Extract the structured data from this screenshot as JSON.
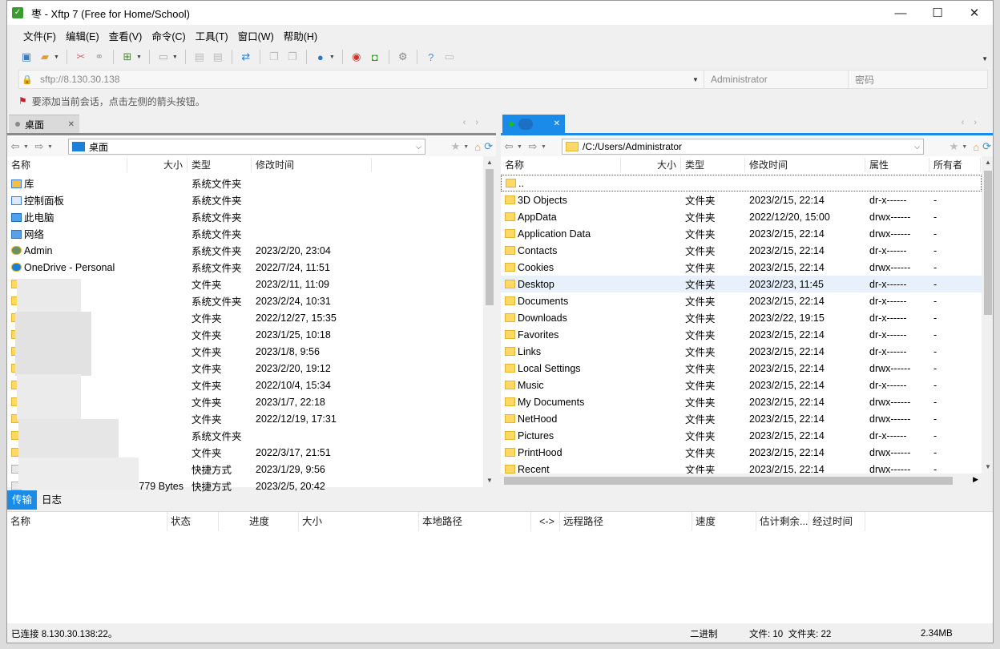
{
  "window": {
    "title": "枣 - Xftp 7 (Free for Home/School)",
    "app_icon": "xftp-icon",
    "minimize": "—",
    "maximize": "☐",
    "close": "✕"
  },
  "menu": [
    "文件(F)",
    "编辑(E)",
    "查看(V)",
    "命令(C)",
    "工具(T)",
    "窗口(W)",
    "帮助(H)"
  ],
  "address": {
    "url": "sftp://8.130.30.138",
    "username_placeholder": "Administrator",
    "password_placeholder": "密码"
  },
  "hint": "要添加当前会话，点击左侧的箭头按钮。",
  "left_pane": {
    "tab_label": "桌面",
    "path": "桌面",
    "columns": [
      "名称",
      "大小",
      "类型",
      "修改时间"
    ],
    "rows": [
      {
        "name": "库",
        "size": "",
        "type": "系统文件夹",
        "modified": "",
        "icon": "library-icon"
      },
      {
        "name": "控制面板",
        "size": "",
        "type": "系统文件夹",
        "modified": "",
        "icon": "control-panel-icon"
      },
      {
        "name": "此电脑",
        "size": "",
        "type": "系统文件夹",
        "modified": "",
        "icon": "computer-icon"
      },
      {
        "name": "网络",
        "size": "",
        "type": "系统文件夹",
        "modified": "",
        "icon": "network-icon"
      },
      {
        "name": "Admin",
        "size": "",
        "type": "系统文件夹",
        "modified": "2023/2/20, 23:04",
        "icon": "user-icon"
      },
      {
        "name": "OneDrive - Personal",
        "size": "",
        "type": "系统文件夹",
        "modified": "2022/7/24, 11:51",
        "icon": "cloud-icon"
      },
      {
        "name": "",
        "size": "",
        "type": "文件夹",
        "modified": "2023/2/11, 11:09",
        "icon": "folder-icon"
      },
      {
        "name": "",
        "size": "",
        "type": "系统文件夹",
        "modified": "2023/2/24, 10:31",
        "icon": "folder-icon"
      },
      {
        "name": "",
        "size": "",
        "type": "文件夹",
        "modified": "2022/12/27, 15:35",
        "icon": "folder-icon"
      },
      {
        "name": "",
        "size": "",
        "type": "文件夹",
        "modified": "2023/1/25, 10:18",
        "icon": "folder-icon"
      },
      {
        "name": "",
        "size": "",
        "type": "文件夹",
        "modified": "2023/1/8, 9:56",
        "icon": "folder-icon"
      },
      {
        "name": "",
        "size": "",
        "type": "文件夹",
        "modified": "2023/2/20, 19:12",
        "icon": "folder-icon"
      },
      {
        "name": "",
        "size": "",
        "type": "文件夹",
        "modified": "2022/10/4, 15:34",
        "icon": "folder-icon"
      },
      {
        "name": "",
        "size": "",
        "type": "文件夹",
        "modified": "2023/1/7, 22:18",
        "icon": "folder-icon"
      },
      {
        "name": "",
        "size": "",
        "type": "文件夹",
        "modified": "2022/12/19, 17:31",
        "icon": "folder-icon"
      },
      {
        "name": "",
        "size": "",
        "type": "系统文件夹",
        "modified": "",
        "icon": "folder-icon"
      },
      {
        "name": "",
        "size": "",
        "type": "文件夹",
        "modified": "2022/3/17, 21:51",
        "icon": "folder-icon"
      },
      {
        "name": "",
        "size": "",
        "type": "快捷方式",
        "modified": "2023/1/29, 9:56",
        "icon": "shortcut-icon"
      },
      {
        "name": "",
        "size": "779 Bytes",
        "type": "快捷方式",
        "modified": "2023/2/5, 20:42",
        "icon": "shortcut-icon"
      }
    ]
  },
  "right_pane": {
    "tab_label": "",
    "path": "/C:/Users/Administrator",
    "columns": [
      "名称",
      "大小",
      "类型",
      "修改时间",
      "属性",
      "所有者"
    ],
    "parent_row": "..",
    "rows": [
      {
        "name": "3D Objects",
        "size": "",
        "type": "文件夹",
        "modified": "2023/2/15, 22:14",
        "attr": "dr-x------",
        "owner": "-"
      },
      {
        "name": "AppData",
        "size": "",
        "type": "文件夹",
        "modified": "2022/12/20, 15:00",
        "attr": "drwx------",
        "owner": "-"
      },
      {
        "name": "Application Data",
        "size": "",
        "type": "文件夹",
        "modified": "2023/2/15, 22:14",
        "attr": "drwx------",
        "owner": "-"
      },
      {
        "name": "Contacts",
        "size": "",
        "type": "文件夹",
        "modified": "2023/2/15, 22:14",
        "attr": "dr-x------",
        "owner": "-"
      },
      {
        "name": "Cookies",
        "size": "",
        "type": "文件夹",
        "modified": "2023/2/15, 22:14",
        "attr": "drwx------",
        "owner": "-"
      },
      {
        "name": "Desktop",
        "size": "",
        "type": "文件夹",
        "modified": "2023/2/23, 11:45",
        "attr": "dr-x------",
        "owner": "-"
      },
      {
        "name": "Documents",
        "size": "",
        "type": "文件夹",
        "modified": "2023/2/15, 22:14",
        "attr": "dr-x------",
        "owner": "-"
      },
      {
        "name": "Downloads",
        "size": "",
        "type": "文件夹",
        "modified": "2023/2/22, 19:15",
        "attr": "dr-x------",
        "owner": "-"
      },
      {
        "name": "Favorites",
        "size": "",
        "type": "文件夹",
        "modified": "2023/2/15, 22:14",
        "attr": "dr-x------",
        "owner": "-"
      },
      {
        "name": "Links",
        "size": "",
        "type": "文件夹",
        "modified": "2023/2/15, 22:14",
        "attr": "dr-x------",
        "owner": "-"
      },
      {
        "name": "Local Settings",
        "size": "",
        "type": "文件夹",
        "modified": "2023/2/15, 22:14",
        "attr": "drwx------",
        "owner": "-"
      },
      {
        "name": "Music",
        "size": "",
        "type": "文件夹",
        "modified": "2023/2/15, 22:14",
        "attr": "dr-x------",
        "owner": "-"
      },
      {
        "name": "My Documents",
        "size": "",
        "type": "文件夹",
        "modified": "2023/2/15, 22:14",
        "attr": "drwx------",
        "owner": "-"
      },
      {
        "name": "NetHood",
        "size": "",
        "type": "文件夹",
        "modified": "2023/2/15, 22:14",
        "attr": "drwx------",
        "owner": "-"
      },
      {
        "name": "Pictures",
        "size": "",
        "type": "文件夹",
        "modified": "2023/2/15, 22:14",
        "attr": "dr-x------",
        "owner": "-"
      },
      {
        "name": "PrintHood",
        "size": "",
        "type": "文件夹",
        "modified": "2023/2/15, 22:14",
        "attr": "drwx------",
        "owner": "-"
      },
      {
        "name": "Recent",
        "size": "",
        "type": "文件夹",
        "modified": "2023/2/15, 22:14",
        "attr": "drwx------",
        "owner": "-"
      }
    ],
    "selected_row": "Desktop"
  },
  "bottom": {
    "tabs": [
      "传输",
      "日志"
    ],
    "columns": [
      "名称",
      "状态",
      "进度",
      "大小",
      "本地路径",
      "<->",
      "远程路径",
      "速度",
      "估计剩余...",
      "经过时间"
    ]
  },
  "status": {
    "connection": "已连接 8.130.30.138:22。",
    "mode": "二进制",
    "counts": "文件: 10  文件夹: 22",
    "size": "2.34MB"
  },
  "colors": {
    "accent": "#1a8be8",
    "folder": "#ffd966",
    "selected_row": "#e8f1fb",
    "status_connected": "#16c21a"
  }
}
